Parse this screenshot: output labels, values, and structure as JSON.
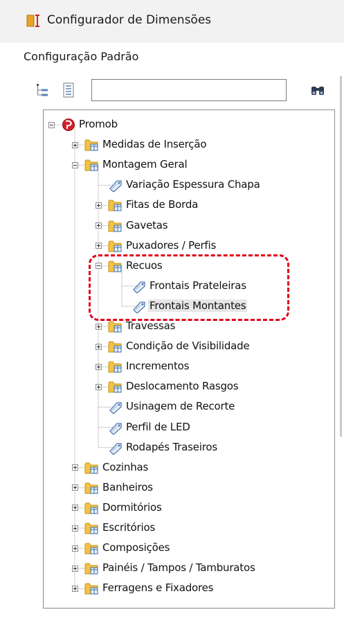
{
  "window": {
    "title": "Configurador de Dimensões"
  },
  "configuration": {
    "label": "Configuração Padrão"
  },
  "search": {
    "value": ""
  },
  "tree": [
    {
      "label": "Promob",
      "icon": "promob-logo-icon",
      "depth": 0,
      "expander": "expanded"
    },
    {
      "label": "Medidas de Inserção",
      "icon": "folder-icon",
      "depth": 1,
      "expander": "collapsed"
    },
    {
      "label": "Montagem Geral",
      "icon": "folder-icon",
      "depth": 1,
      "expander": "expanded"
    },
    {
      "label": "Variação Espessura Chapa",
      "icon": "dimension-tag-icon",
      "depth": 2,
      "expander": "none"
    },
    {
      "label": "Fitas de Borda",
      "icon": "folder-icon",
      "depth": 2,
      "expander": "collapsed"
    },
    {
      "label": "Gavetas",
      "icon": "folder-icon",
      "depth": 2,
      "expander": "collapsed"
    },
    {
      "label": "Puxadores / Perfis",
      "icon": "folder-icon",
      "depth": 2,
      "expander": "collapsed"
    },
    {
      "label": "Recuos",
      "icon": "folder-icon",
      "depth": 2,
      "expander": "expanded"
    },
    {
      "label": "Frontais Prateleiras",
      "icon": "dimension-tag-icon",
      "depth": 3,
      "expander": "none"
    },
    {
      "label": "Frontais Montantes",
      "icon": "dimension-tag-icon",
      "depth": 3,
      "expander": "none",
      "selected": true
    },
    {
      "label": "Travessas",
      "icon": "folder-icon",
      "depth": 2,
      "expander": "collapsed"
    },
    {
      "label": "Condição de Visibilidade",
      "icon": "folder-icon",
      "depth": 2,
      "expander": "collapsed"
    },
    {
      "label": "Incrementos",
      "icon": "folder-icon",
      "depth": 2,
      "expander": "collapsed"
    },
    {
      "label": "Deslocamento Rasgos",
      "icon": "folder-icon",
      "depth": 2,
      "expander": "collapsed"
    },
    {
      "label": "Usinagem de Recorte",
      "icon": "dimension-tag-icon",
      "depth": 2,
      "expander": "none"
    },
    {
      "label": "Perfil de LED",
      "icon": "dimension-tag-icon",
      "depth": 2,
      "expander": "none"
    },
    {
      "label": "Rodapés Traseiros",
      "icon": "dimension-tag-icon",
      "depth": 2,
      "expander": "none"
    },
    {
      "label": "Cozinhas",
      "icon": "folder-icon",
      "depth": 1,
      "expander": "collapsed"
    },
    {
      "label": "Banheiros",
      "icon": "folder-icon",
      "depth": 1,
      "expander": "collapsed"
    },
    {
      "label": "Dormitórios",
      "icon": "folder-icon",
      "depth": 1,
      "expander": "collapsed"
    },
    {
      "label": "Escritórios",
      "icon": "folder-icon",
      "depth": 1,
      "expander": "collapsed"
    },
    {
      "label": "Composições",
      "icon": "folder-icon",
      "depth": 1,
      "expander": "collapsed"
    },
    {
      "label": "Painéis / Tampos / Tamburatos",
      "icon": "folder-icon",
      "depth": 1,
      "expander": "collapsed"
    },
    {
      "label": "Ferragens e Fixadores",
      "icon": "folder-icon",
      "depth": 1,
      "expander": "collapsed"
    }
  ],
  "colors": {
    "highlight": "#e0001b",
    "folder": "#f5c242",
    "tag": "#6c8ebf",
    "promob": "#d4202a"
  }
}
